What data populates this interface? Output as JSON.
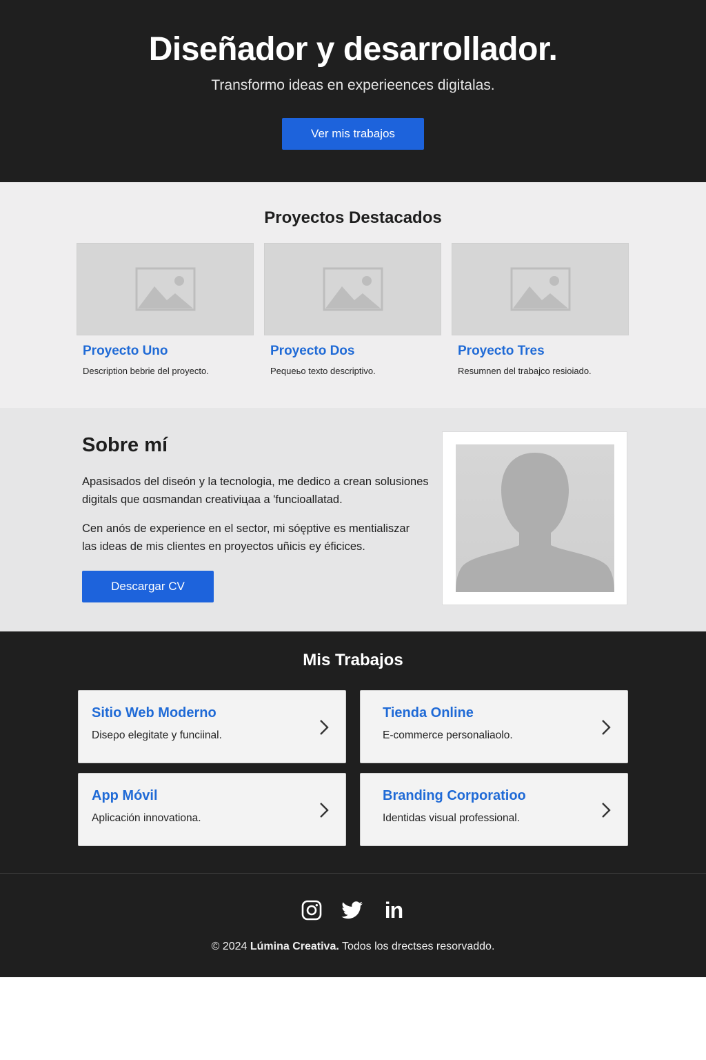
{
  "hero": {
    "title": "Diseñador y desarrollador.",
    "subtitle": "Transformo ideas en experieences digitalas.",
    "cta_label": "Ver mis trabajos"
  },
  "projects": {
    "title": "Proyectos Destacados",
    "items": [
      {
        "name": "Proyecto Uno",
        "description": "Description bebrie del proyecto."
      },
      {
        "name": "Proyecto Dos",
        "description": "Pequeьo texto descriptivo."
      },
      {
        "name": "Proyecto Tres",
        "description": "Resumnen del trabajсo resioiado."
      }
    ]
  },
  "about": {
    "title": "Sobre mí",
    "paragraph1": "Apasisados del diseón y la tecnologia, me dedico a crean solusiones digitals que ɑɑsmandan creativiцaa a 'funcioallatad.",
    "paragraph2": "Cen anós de experience en el sector, mi sóęptive es mentialiszar las ideas de mis clientes en proyectos uñicis ey éficices.",
    "cv_label": "Descargar CV"
  },
  "works": {
    "title": "Mis Trabajos",
    "items": [
      {
        "title": "Sitio Web Moderno",
        "description": "Diseρo elegitate y funciinal."
      },
      {
        "title": "Tienda Online",
        "description": "E-commerce personaliaolo."
      },
      {
        "title": "App Móvil",
        "description": "Aplicación innovationa."
      },
      {
        "title": "Branding Corporatioo",
        "description": "Identidas visual professional."
      }
    ]
  },
  "footer": {
    "social": [
      "instagram-icon",
      "twitter-icon",
      "linkedin-icon"
    ],
    "linkedin_text": "in",
    "copyright_prefix": "© 2024",
    "brand": "Lúmina Creativa.",
    "copyright_suffix": "Todos los drectses resorvaddo."
  },
  "colors": {
    "dark_bg": "#1f1f1f",
    "accent": "#1d63dc",
    "link_blue": "#1f6ad6",
    "light_bg": "#efeeef",
    "about_bg": "#e6e6e7"
  }
}
